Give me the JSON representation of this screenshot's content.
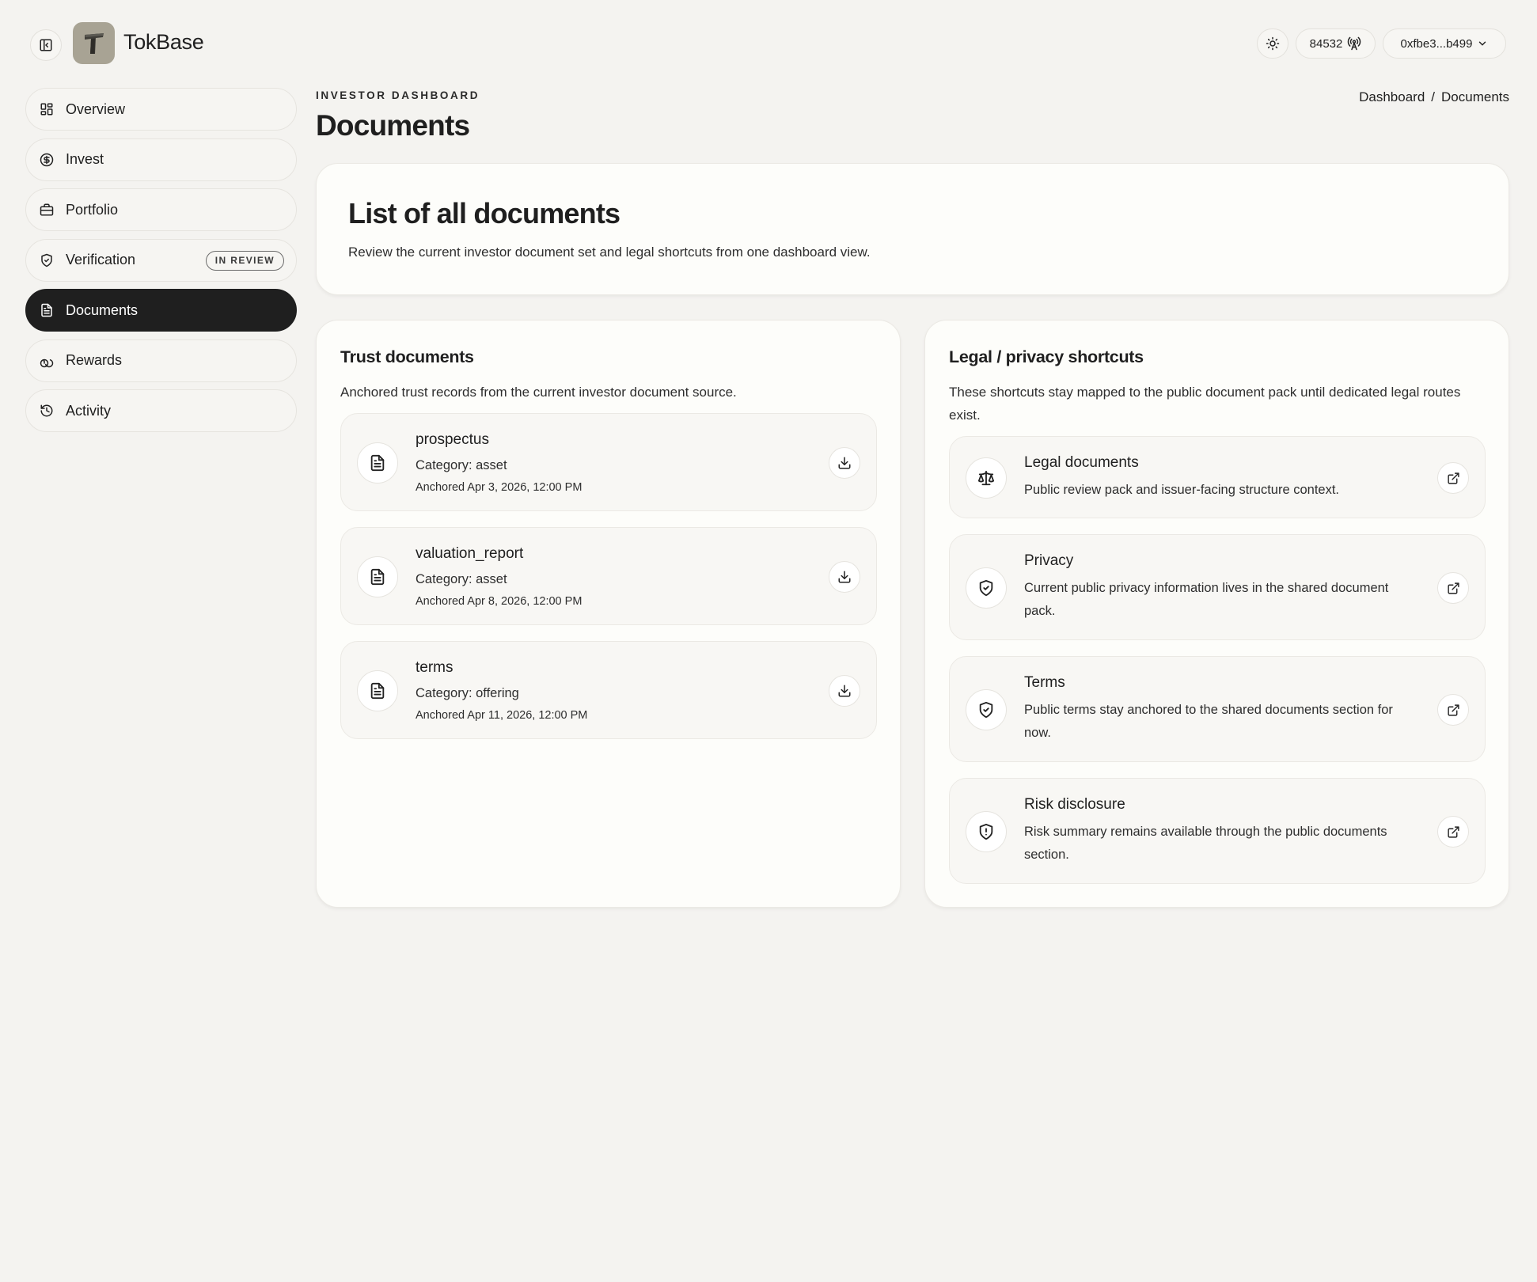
{
  "app": {
    "brand": "TokBase"
  },
  "topbar": {
    "chain_id": "84532",
    "wallet": "0xfbe3...b499"
  },
  "sidebar": {
    "items": [
      {
        "label": "Overview",
        "icon": "grid-icon"
      },
      {
        "label": "Invest",
        "icon": "dollar-circle-icon"
      },
      {
        "label": "Portfolio",
        "icon": "briefcase-icon"
      },
      {
        "label": "Verification",
        "icon": "shield-check-icon",
        "badge": "IN REVIEW"
      },
      {
        "label": "Documents",
        "icon": "file-text-icon",
        "active": true
      },
      {
        "label": "Rewards",
        "icon": "coins-icon"
      },
      {
        "label": "Activity",
        "icon": "history-icon"
      }
    ]
  },
  "header": {
    "eyebrow": "INVESTOR DASHBOARD",
    "title": "Documents",
    "breadcrumb": [
      "Dashboard",
      "/",
      "Documents"
    ]
  },
  "hero": {
    "title": "List of all documents",
    "description": "Review the current investor document set and legal shortcuts from one dashboard view."
  },
  "trust": {
    "title": "Trust documents",
    "description": "Anchored trust records from the current investor document source.",
    "documents": [
      {
        "name": "prospectus",
        "category": "Category: asset",
        "anchored": "Anchored Apr 3, 2026, 12:00 PM"
      },
      {
        "name": "valuation_report",
        "category": "Category: asset",
        "anchored": "Anchored Apr 8, 2026, 12:00 PM"
      },
      {
        "name": "terms",
        "category": "Category: offering",
        "anchored": "Anchored Apr 11, 2026, 12:00 PM"
      }
    ]
  },
  "legal": {
    "title": "Legal / privacy shortcuts",
    "description": "These shortcuts stay mapped to the public document pack until dedicated legal routes exist.",
    "shortcuts": [
      {
        "name": "Legal documents",
        "description": "Public review pack and issuer-facing structure context.",
        "icon": "scale-icon"
      },
      {
        "name": "Privacy",
        "description": "Current public privacy information lives in the shared document pack.",
        "icon": "shield-check-icon"
      },
      {
        "name": "Terms",
        "description": "Public terms stay anchored to the shared documents section for now.",
        "icon": "shield-check-icon"
      },
      {
        "name": "Risk disclosure",
        "description": "Risk summary remains available through the public documents section.",
        "icon": "shield-alert-icon"
      }
    ]
  },
  "colors": {
    "background": "#f4f3f0",
    "card": "#fdfdfa",
    "active_nav": "#1f1f1f",
    "logo": "#a8a394"
  }
}
